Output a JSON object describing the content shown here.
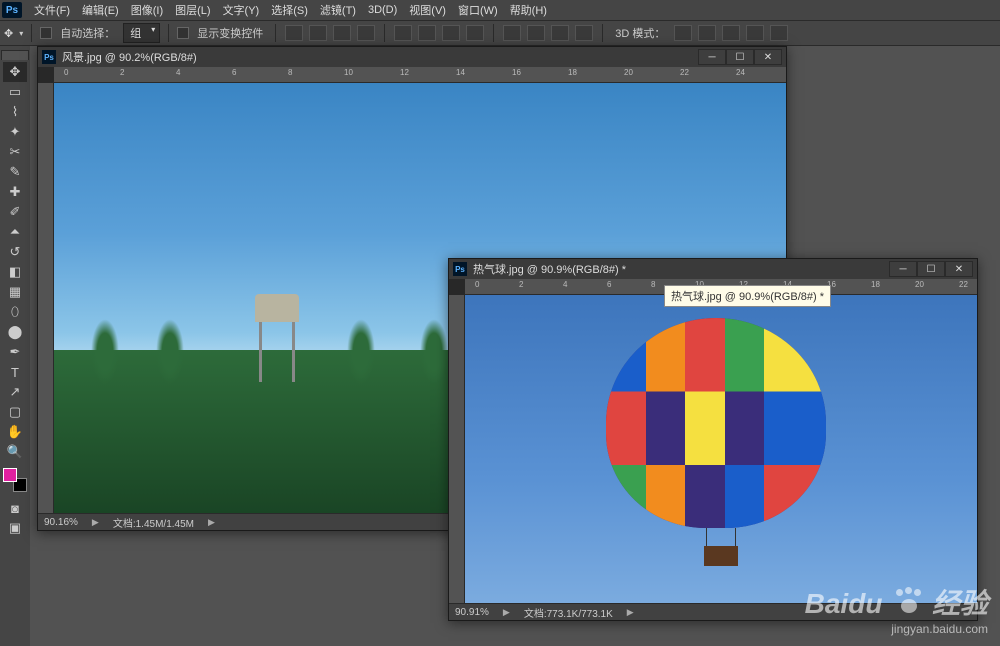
{
  "app": {
    "logo": "Ps"
  },
  "menu": {
    "items": [
      "文件(F)",
      "编辑(E)",
      "图像(I)",
      "图层(L)",
      "文字(Y)",
      "选择(S)",
      "滤镜(T)",
      "3D(D)",
      "视图(V)",
      "窗口(W)",
      "帮助(H)"
    ]
  },
  "options": {
    "auto_select_label": "自动选择：",
    "group_dropdown": "组",
    "transform_controls_label": "显示变换控件",
    "mode_3d_label": "3D 模式："
  },
  "window1": {
    "title": "风景.jpg @ 90.2%(RGB/8#)",
    "zoom": "90.16%",
    "doc_label": "文档:1.45M/1.45M",
    "ruler_marks": [
      "0",
      "2",
      "4",
      "6",
      "8",
      "10",
      "12",
      "14",
      "16",
      "18",
      "20",
      "22",
      "24"
    ]
  },
  "window2": {
    "title": "热气球.jpg @ 90.9%(RGB/8#) *",
    "zoom": "90.91%",
    "doc_label": "文档:773.1K/773.1K",
    "ruler_marks": [
      "0",
      "2",
      "4",
      "6",
      "8",
      "10",
      "12",
      "14",
      "16",
      "18",
      "20",
      "22"
    ]
  },
  "tooltip": {
    "text": "热气球.jpg @ 90.9%(RGB/8#) *"
  },
  "watermark": {
    "main": "Baidu",
    "suffix": "经验",
    "url": "jingyan.baidu.com"
  }
}
